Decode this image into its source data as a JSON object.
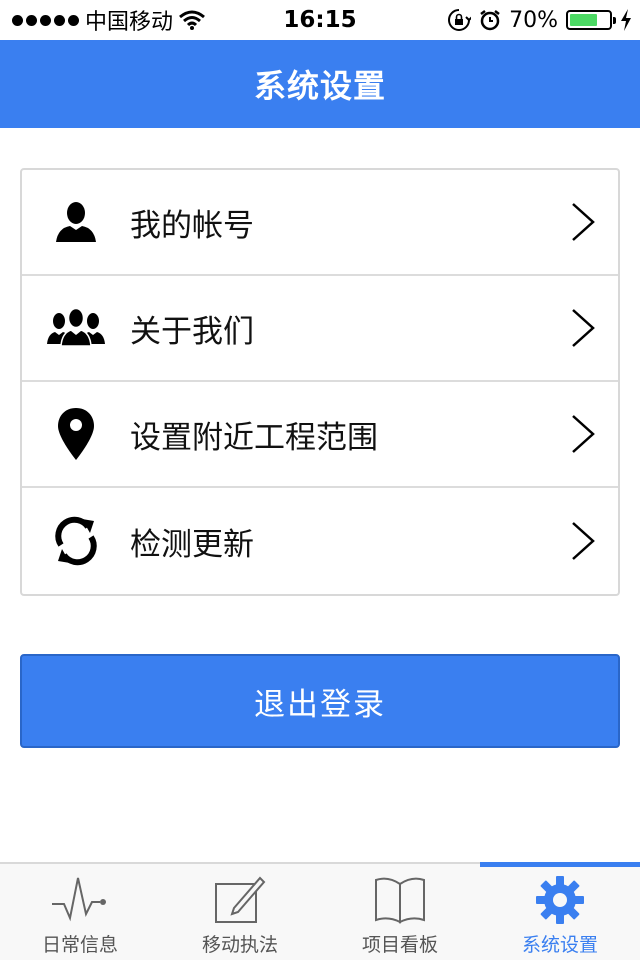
{
  "status_bar": {
    "carrier": "中国移动",
    "time": "16:15",
    "battery_percent": "70%",
    "battery_level": 0.7,
    "icons": [
      "signal-dots-icon",
      "wifi-icon",
      "rotation-lock-icon",
      "alarm-icon",
      "battery-icon",
      "charging-icon"
    ]
  },
  "header": {
    "title": "系统设置"
  },
  "menu": {
    "items": [
      {
        "label": "我的帐号",
        "icon": "user-icon"
      },
      {
        "label": "关于我们",
        "icon": "group-icon"
      },
      {
        "label": "设置附近工程范围",
        "icon": "map-pin-icon"
      },
      {
        "label": "检测更新",
        "icon": "refresh-icon"
      }
    ]
  },
  "logout": {
    "label": "退出登录"
  },
  "tabs": [
    {
      "label": "日常信息",
      "icon": "pulse-icon",
      "active": false
    },
    {
      "label": "移动执法",
      "icon": "edit-icon",
      "active": false
    },
    {
      "label": "项目看板",
      "icon": "book-icon",
      "active": false
    },
    {
      "label": "系统设置",
      "icon": "gear-icon",
      "active": true
    }
  ],
  "colors": {
    "accent": "#3a7ff0",
    "battery": "#4cd964",
    "divider": "#dcdcdc"
  }
}
